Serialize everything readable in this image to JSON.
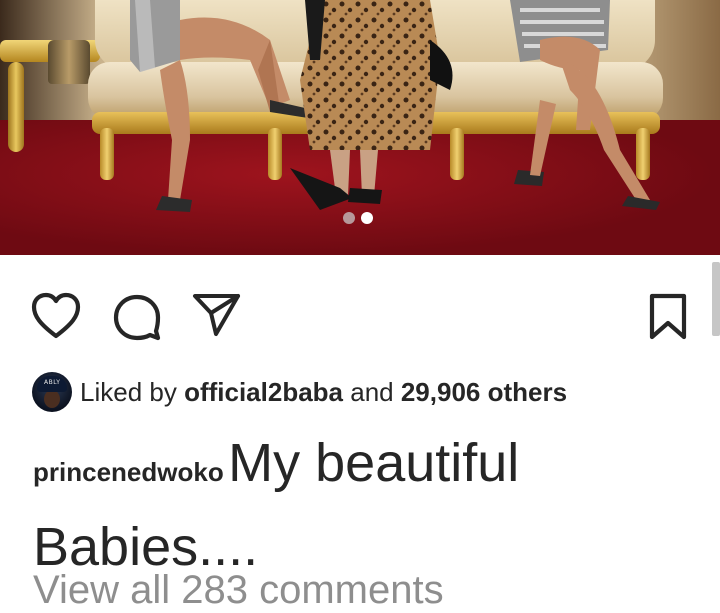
{
  "post": {
    "carousel": {
      "total_slides": 2,
      "active_slide": 2
    },
    "actions": {
      "like": "heart-outline-icon",
      "comment": "comment-bubble-icon",
      "share": "paper-plane-icon",
      "save": "bookmark-outline-icon"
    },
    "likes": {
      "prefix": "Liked by ",
      "liked_by_user": "official2baba",
      "joiner": " and ",
      "others": "29,906 others",
      "avatar_cap_text": "ABLY"
    },
    "caption": {
      "username": "princenedwoko",
      "text": "My beautiful Babies...."
    },
    "view_all_comments": "View all 283 comments"
  },
  "colors": {
    "text": "#262626",
    "muted": "#8e8e8e",
    "background": "#ffffff"
  }
}
